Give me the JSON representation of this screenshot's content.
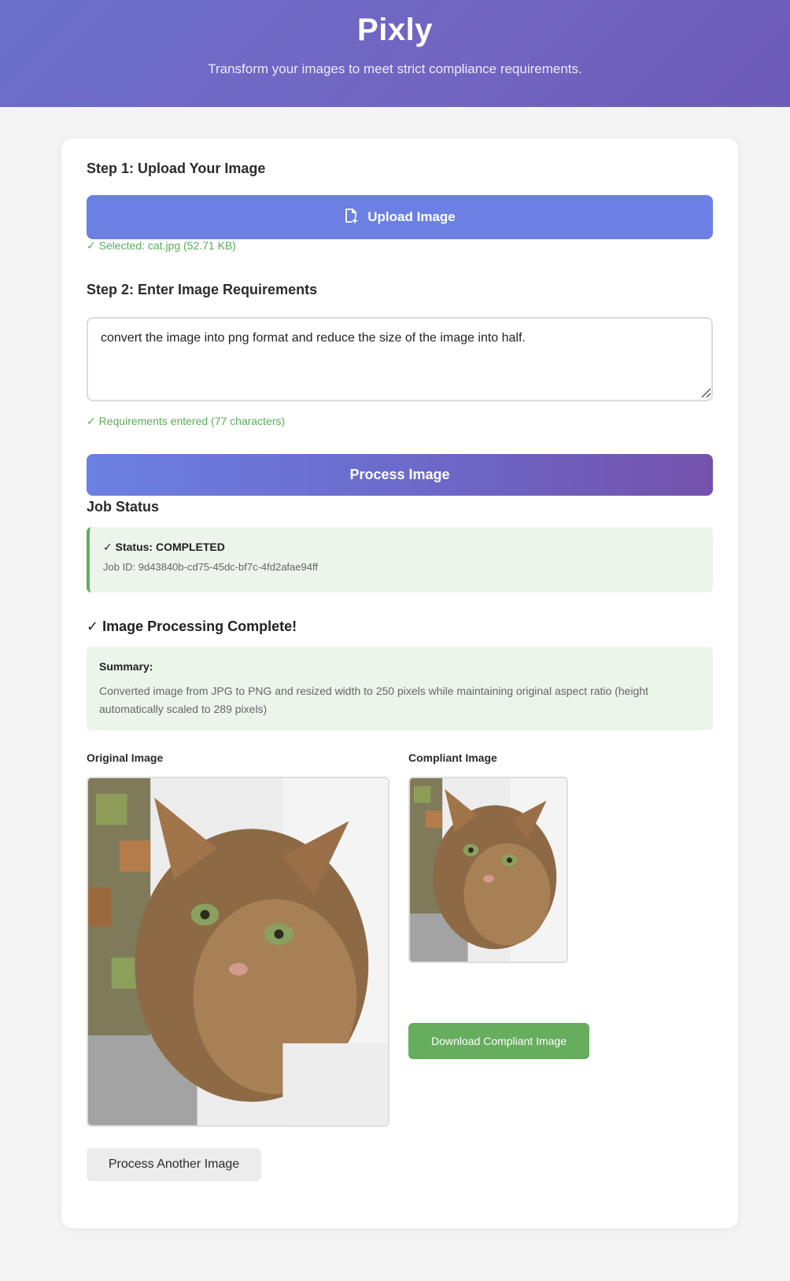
{
  "header": {
    "title": "Pixly",
    "subtitle": "Transform your images to meet strict compliance requirements."
  },
  "step1": {
    "title": "Step 1: Upload Your Image",
    "upload_label": "Upload Image",
    "upload_icon": "file-plus-icon",
    "selected_text": "✓ Selected: cat.jpg (52.71 KB)"
  },
  "step2": {
    "title": "Step 2: Enter Image Requirements",
    "requirements_value": "convert the image into png format and reduce the size of the image into half.",
    "entered_text": "✓ Requirements entered (77 characters)"
  },
  "process_label": "Process Image",
  "job": {
    "title": "Job Status",
    "status_text": "✓ Status: COMPLETED",
    "job_id_text": "Job ID: 9d43840b-cd75-45dc-bf7c-4fd2afae94ff"
  },
  "result": {
    "title": "✓ Image Processing Complete!",
    "summary_label": "Summary:",
    "summary_text": "Converted image from JPG to PNG and resized width to 250 pixels while maintaining original aspect ratio (height automatically scaled to 289 pixels)",
    "original_label": "Original Image",
    "compliant_label": "Compliant Image",
    "download_label": "Download Compliant Image",
    "another_label": "Process Another Image"
  },
  "colors": {
    "header_gradient_start": "#6a70c9",
    "header_gradient_end": "#6c5bb8",
    "primary_button": "#6b80e2",
    "success_green": "#5bab5b",
    "success_bg": "#ebf5ea",
    "download_button": "#66ad5e"
  }
}
